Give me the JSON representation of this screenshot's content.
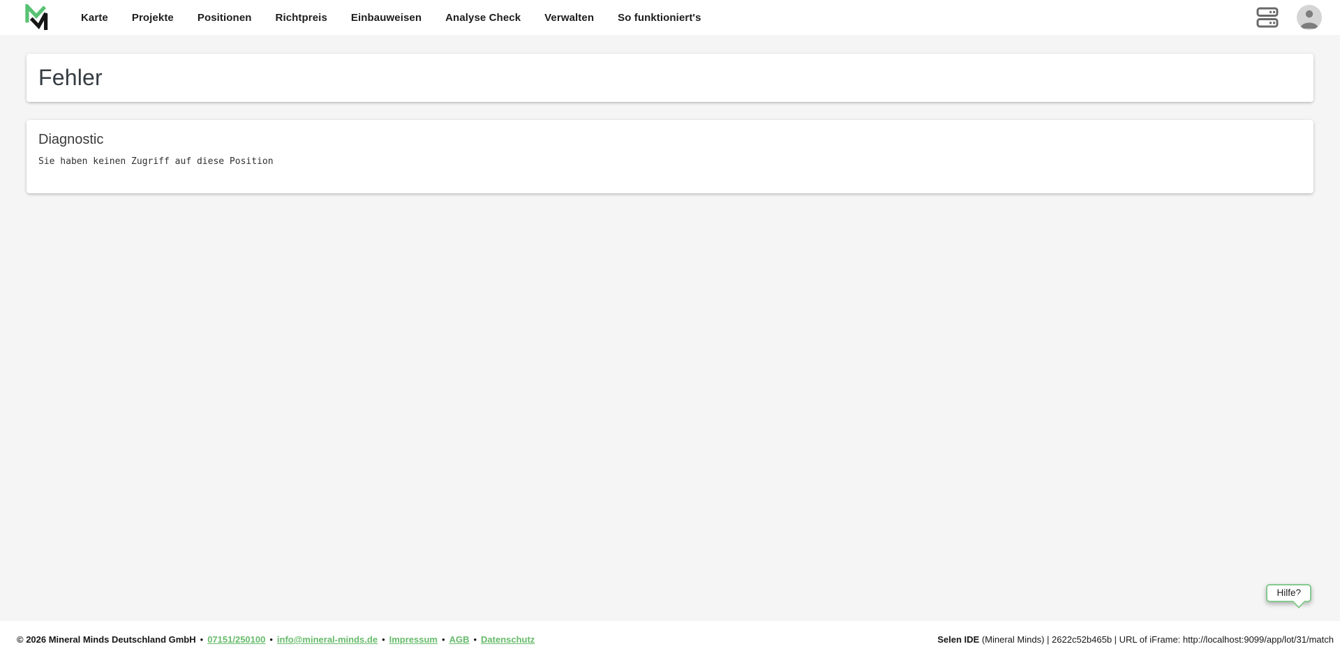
{
  "topbar": {
    "nav_items": [
      "Karte",
      "Projekte",
      "Positionen",
      "Richtpreis",
      "Einbauweisen",
      "Analyse Check",
      "Verwalten",
      "So funktioniert's"
    ],
    "icons": {
      "logo": "mineral-minds-logo",
      "server": "server-icon",
      "avatar": "user-avatar-icon"
    }
  },
  "main": {
    "error_title": "Fehler",
    "diagnostic": {
      "heading": "Diagnostic",
      "message": "Sie haben keinen Zugriff auf diese Position"
    }
  },
  "help": {
    "label": "Hilfe?"
  },
  "footer": {
    "copyright": "© 2026 Mineral Minds Deutschland GmbH",
    "separator": "•",
    "links": [
      "07151/250100",
      "info@mineral-minds.de",
      "Impressum",
      "AGB",
      "Datenschutz"
    ],
    "debug": {
      "brand": "Selen IDE",
      "rest": " (Mineral Minds) | 2622c52b465b | URL of iFrame: http://localhost:9099/app/lot/31/match"
    }
  },
  "colors": {
    "background": "#f5f5f5",
    "accent_green": "#66bb6a",
    "logo_green": "#58c273",
    "logo_black": "#161616",
    "help_border": "#85c88e",
    "heading": "#343b41",
    "icon_gray": "#696969"
  }
}
